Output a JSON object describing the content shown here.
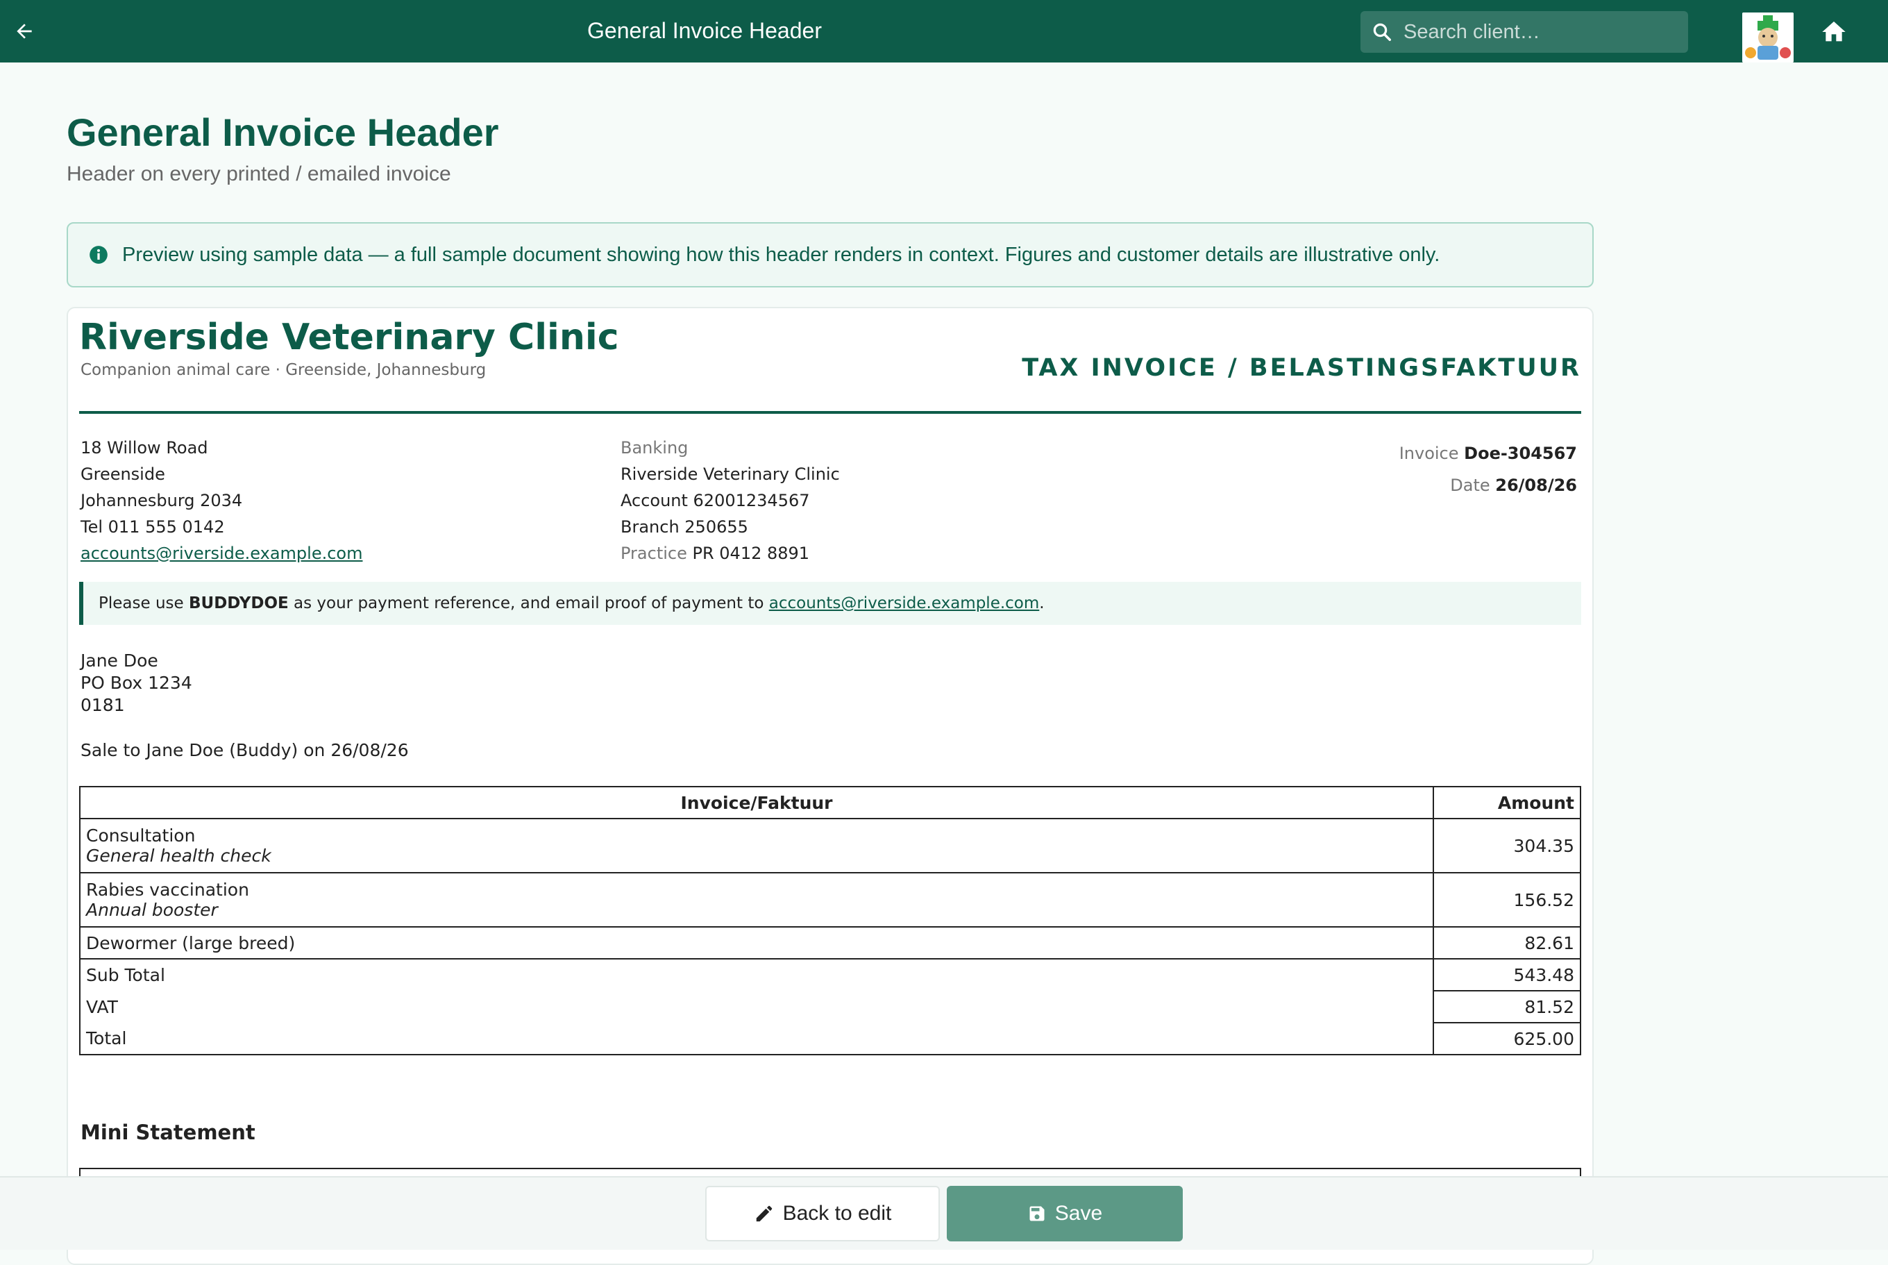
{
  "topbar": {
    "title": "General Invoice Header",
    "search_placeholder": "Search client…",
    "back_icon": "arrow-left-icon",
    "home_icon": "home-icon"
  },
  "page": {
    "title": "General Invoice Header",
    "subtitle": "Header on every printed / emailed invoice"
  },
  "banner": {
    "text": "Preview using sample data — a full sample document showing how this header renders in context. Figures and customer details are illustrative only."
  },
  "invoice": {
    "clinic_name": "Riverside Veterinary Clinic",
    "clinic_tagline": "Companion animal care · Greenside, Johannesburg",
    "doc_type": "TAX INVOICE / BELASTINGSFAKTUUR",
    "address": {
      "line1": "18 Willow Road",
      "line2": "Greenside",
      "line3": "Johannesburg 2034",
      "phone": "Tel 011 555 0142",
      "email": "accounts@riverside.example.com"
    },
    "banking": {
      "heading": "Banking",
      "name": "Riverside Veterinary Clinic",
      "account": "Account 62001234567",
      "branch": "Branch 250655",
      "practice_label": "Practice",
      "practice_value": "PR 0412 8891"
    },
    "meta": {
      "invoice_label": "Invoice",
      "invoice_value": "Doe-304567",
      "date_label": "Date",
      "date_value": "26/08/26"
    },
    "payref": {
      "prefix": "Please use",
      "reference": "BUDDYDOE",
      "middle": "as your payment reference, and email proof of payment to",
      "email": "accounts@riverside.example.com",
      "suffix": "."
    },
    "client": {
      "name": "Jane Doe",
      "address1": "PO Box 1234",
      "postcode": "0181"
    },
    "sale_line": "Sale to Jane Doe (Buddy) on 26/08/26",
    "table": {
      "col_description": "Invoice/Faktuur",
      "col_amount": "Amount",
      "items": [
        {
          "name": "Consultation",
          "detail": "General health check",
          "amount": "304.35"
        },
        {
          "name": "Rabies vaccination",
          "detail": "Annual booster",
          "amount": "156.52"
        },
        {
          "name": "Dewormer (large breed)",
          "detail": "",
          "amount": "82.61"
        }
      ],
      "subtotal_label": "Sub Total",
      "subtotal": "543.48",
      "vat_label": "VAT",
      "vat": "81.52",
      "total_label": "Total",
      "total": "625.00"
    },
    "mini_statement_title": "Mini Statement"
  },
  "actions": {
    "back_label": "Back to edit",
    "save_label": "Save"
  },
  "colors": {
    "brand": "#0d5c49",
    "save_button": "#5c9986",
    "banner_bg": "#eef8f4"
  }
}
